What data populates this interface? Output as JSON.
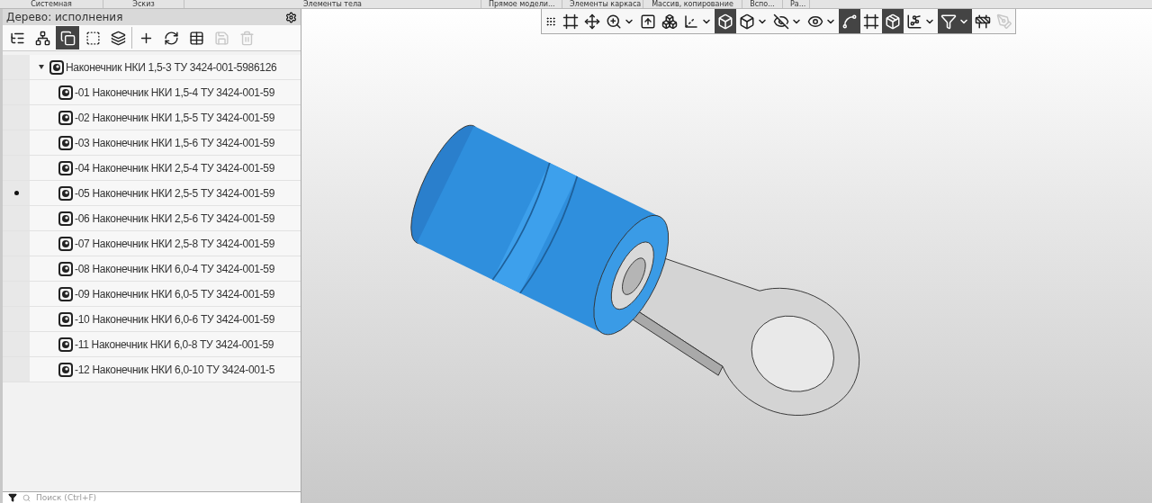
{
  "ribbon_groups": [
    "Системная",
    "Эскиз",
    "Элементы тела",
    "Прямое модели...",
    "Элементы каркаса",
    "Массив, копирование",
    "Вспо...",
    "Ра..."
  ],
  "tree_panel": {
    "title": "Дерево: исполнения",
    "toolbar": [
      {
        "active": false,
        "disabled": false
      },
      {
        "active": false,
        "disabled": false
      },
      {
        "active": true,
        "disabled": false
      },
      {
        "active": false,
        "disabled": false
      },
      {
        "active": false,
        "disabled": false
      },
      {
        "active": false,
        "disabled": false
      },
      {
        "active": false,
        "disabled": false
      },
      {
        "active": false,
        "disabled": false
      },
      {
        "active": false,
        "disabled": true
      },
      {
        "active": false,
        "disabled": true
      }
    ],
    "tree": [
      {
        "label": "Наконечник НКИ 1,5-3 ТУ 3424-001-5986126",
        "current": false,
        "expanded": true,
        "children": [
          {
            "label": "-01 Наконечник НКИ 1,5-4 ТУ 3424-001-59",
            "current": false
          },
          {
            "label": "-02 Наконечник НКИ 1,5-5 ТУ 3424-001-59",
            "current": false
          },
          {
            "label": "-03 Наконечник НКИ 1,5-6 ТУ 3424-001-59",
            "current": false
          },
          {
            "label": "-04 Наконечник НКИ 2,5-4 ТУ 3424-001-59",
            "current": false
          },
          {
            "label": "-05 Наконечник НКИ 2,5-5 ТУ 3424-001-59",
            "current": true
          },
          {
            "label": "-06 Наконечник НКИ 2,5-6 ТУ 3424-001-59",
            "current": false
          },
          {
            "label": "-07 Наконечник НКИ 2,5-8 ТУ 3424-001-59",
            "current": false
          },
          {
            "label": "-08 Наконечник НКИ 6,0-4 ТУ 3424-001-59",
            "current": false
          },
          {
            "label": "-09 Наконечник НКИ 6,0-5 ТУ 3424-001-59",
            "current": false
          },
          {
            "label": "-10 Наконечник НКИ 6,0-6 ТУ 3424-001-59",
            "current": false
          },
          {
            "label": "-11 Наконечник НКИ 6,0-8 ТУ 3424-001-59",
            "current": false
          },
          {
            "label": "-12 Наконечник НКИ 6,0-10 ТУ 3424-001-5",
            "current": false
          }
        ]
      }
    ],
    "search": {
      "placeholder": "Поиск (Ctrl+F)"
    }
  },
  "view_toolbar": [
    {
      "active": false,
      "disabled": false,
      "dropdown": false
    },
    {
      "active": false,
      "disabled": false,
      "dropdown": false
    },
    {
      "active": false,
      "disabled": false,
      "dropdown": true
    },
    {
      "active": false,
      "disabled": false,
      "dropdown": false
    },
    {
      "active": false,
      "disabled": false,
      "dropdown": false
    },
    {
      "active": false,
      "disabled": false,
      "dropdown": true
    },
    {
      "active": true,
      "disabled": false,
      "dropdown": false
    },
    {
      "active": false,
      "disabled": false,
      "dropdown": true
    },
    {
      "active": false,
      "disabled": false,
      "dropdown": true
    },
    {
      "active": false,
      "disabled": false,
      "dropdown": true
    },
    {
      "active": true,
      "disabled": false,
      "dropdown": false
    },
    {
      "active": false,
      "disabled": false,
      "dropdown": false
    },
    {
      "active": true,
      "disabled": false,
      "dropdown": false
    },
    {
      "active": false,
      "disabled": false,
      "dropdown": true
    },
    {
      "active": true,
      "disabled": false,
      "dropdown": true
    },
    {
      "active": false,
      "disabled": false,
      "dropdown": false
    },
    {
      "active": false,
      "disabled": true,
      "dropdown": false
    }
  ]
}
